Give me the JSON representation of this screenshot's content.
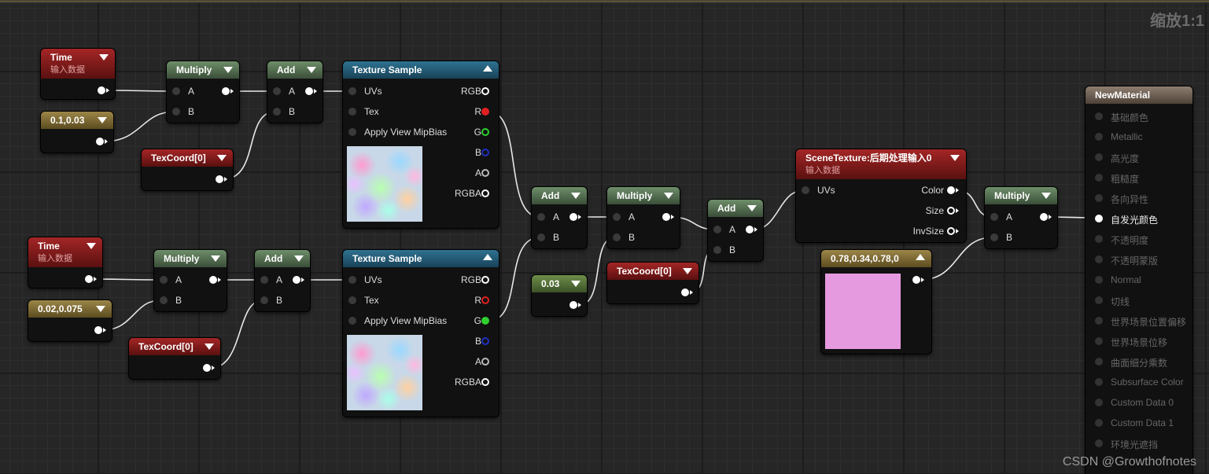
{
  "zoom_label": "缩放1:1",
  "watermark": "CSDN @Growthofnotes",
  "nodes": {
    "time1": {
      "title": "Time",
      "subtitle": "输入数据"
    },
    "const1": {
      "title": "0.1,0.03"
    },
    "mul1": {
      "title": "Multiply",
      "pin_a": "A",
      "pin_b": "B"
    },
    "add1": {
      "title": "Add",
      "pin_a": "A",
      "pin_b": "B"
    },
    "texcoord1": {
      "title": "TexCoord[0]"
    },
    "tex1": {
      "title": "Texture Sample",
      "in": [
        "UVs",
        "Tex",
        "Apply View MipBias"
      ],
      "out": [
        "RGB",
        "R",
        "G",
        "B",
        "A",
        "RGBA"
      ]
    },
    "time2": {
      "title": "Time",
      "subtitle": "输入数据"
    },
    "const2": {
      "title": "0.02,0.075"
    },
    "mul2": {
      "title": "Multiply",
      "pin_a": "A",
      "pin_b": "B"
    },
    "add2": {
      "title": "Add",
      "pin_a": "A",
      "pin_b": "B"
    },
    "texcoord2": {
      "title": "TexCoord[0]"
    },
    "tex2": {
      "title": "Texture Sample",
      "in": [
        "UVs",
        "Tex",
        "Apply View MipBias"
      ],
      "out": [
        "RGB",
        "R",
        "G",
        "B",
        "A",
        "RGBA"
      ]
    },
    "add3": {
      "title": "Add",
      "pin_a": "A",
      "pin_b": "B"
    },
    "const3": {
      "title": "0.03"
    },
    "mul3": {
      "title": "Multiply",
      "pin_a": "A",
      "pin_b": "B"
    },
    "texcoord3": {
      "title": "TexCoord[0]"
    },
    "add4": {
      "title": "Add",
      "pin_a": "A",
      "pin_b": "B"
    },
    "scene": {
      "title": "SceneTexture:后期处理输入0",
      "subtitle": "输入数据",
      "in": "UVs",
      "out": [
        "Color",
        "Size",
        "InvSize"
      ]
    },
    "color": {
      "title": "0.78,0.34,0.78,0",
      "swatch": "#e59ae0"
    },
    "mul4": {
      "title": "Multiply",
      "pin_a": "A",
      "pin_b": "B"
    },
    "material": {
      "title": "NewMaterial",
      "inputs": [
        "基础颜色",
        "Metallic",
        "高光度",
        "粗糙度",
        "各向异性",
        "自发光颜色",
        "不透明度",
        "不透明蒙版",
        "Normal",
        "切线",
        "世界场景位置偏移",
        "世界场景位移",
        "曲面细分乘数",
        "Subsurface Color",
        "Custom Data 0",
        "Custom Data 1",
        "环境光遮挡"
      ],
      "active_input": "自发光颜色"
    }
  },
  "colors": {
    "red_pin": "#e02020",
    "green_pin": "#30d030",
    "blue_pin": "#2030c0"
  }
}
